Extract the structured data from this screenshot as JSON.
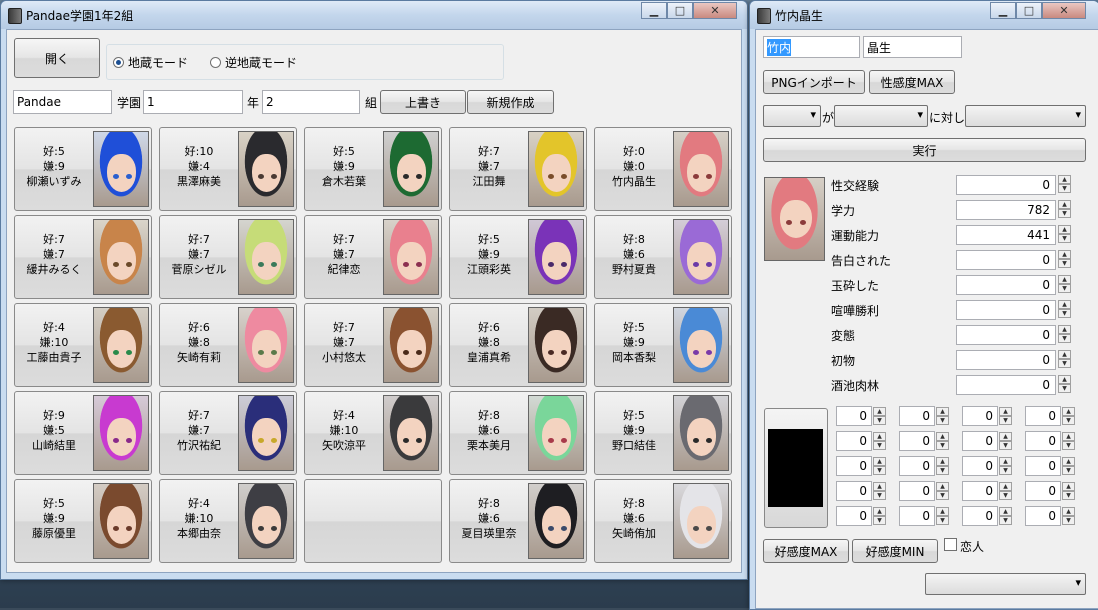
{
  "left_window": {
    "title": "Pandae学園1年2組",
    "open_button": "開く",
    "modes": [
      {
        "label": "地蔵モード",
        "selected": true
      },
      {
        "label": "逆地蔵モード",
        "selected": false
      }
    ],
    "school_name": "Pandae",
    "school_label": "学園",
    "year_value": "1",
    "year_label": "年",
    "class_value": "2",
    "class_label": "組",
    "overwrite_button": "上書き",
    "new_button": "新規作成",
    "students": [
      {
        "like": "好:5",
        "dislike": "嫌:9",
        "name": "柳瀬いずみ",
        "hair": "#1f4fd8",
        "bg": "#cfd8e8",
        "eye": "#2a5fcf"
      },
      {
        "like": "好:10",
        "dislike": "嫌:4",
        "name": "黒澤麻美",
        "hair": "#2a2a2e",
        "bg": "#d9d2c6",
        "eye": "#4a3a33"
      },
      {
        "like": "好:5",
        "dislike": "嫌:9",
        "name": "倉木若葉",
        "hair": "#1d6a32",
        "bg": "#cfcfcf",
        "eye": "#2a2a2a"
      },
      {
        "like": "好:7",
        "dislike": "嫌:7",
        "name": "江田舞",
        "hair": "#e3c52a",
        "bg": "#d8d1c4",
        "eye": "#7a4d2a"
      },
      {
        "like": "好:0",
        "dislike": "嫌:0",
        "name": "竹内晶生",
        "hair": "#e27a80",
        "bg": "#d6cfc6",
        "eye": "#8b3b3b"
      },
      {
        "like": "好:7",
        "dislike": "嫌:7",
        "name": "緩井みるく",
        "hair": "#c8844a",
        "bg": "#dad5ca",
        "eye": "#6b4a2a"
      },
      {
        "like": "好:7",
        "dislike": "嫌:7",
        "name": "菅原シゼル",
        "hair": "#c6dc78",
        "bg": "#d5d5cf",
        "eye": "#3a7a5a"
      },
      {
        "like": "好:7",
        "dislike": "嫌:7",
        "name": "紀律恋",
        "hair": "#e9808e",
        "bg": "#d8d2ca",
        "eye": "#8b3050"
      },
      {
        "like": "好:5",
        "dislike": "嫌:9",
        "name": "江頭彩英",
        "hair": "#7a33b8",
        "bg": "#d0c8d6",
        "eye": "#4a2a6a"
      },
      {
        "like": "好:8",
        "dislike": "嫌:6",
        "name": "野村夏貴",
        "hair": "#9a6ad6",
        "bg": "#d4cdd8",
        "eye": "#6a3aa8"
      },
      {
        "like": "好:4",
        "dislike": "嫌:10",
        "name": "工藤由貴子",
        "hair": "#8a5a30",
        "bg": "#d4cec4",
        "eye": "#2a8a4a"
      },
      {
        "like": "好:6",
        "dislike": "嫌:8",
        "name": "矢崎有莉",
        "hair": "#ee8aa0",
        "bg": "#d8d2cc",
        "eye": "#5a7a4a"
      },
      {
        "like": "好:7",
        "dislike": "嫌:7",
        "name": "小村悠太",
        "hair": "#8a5230",
        "bg": "#d3ccc2",
        "eye": "#4a2a1a"
      },
      {
        "like": "好:6",
        "dislike": "嫌:8",
        "name": "皇浦真希",
        "hair": "#3a2a24",
        "bg": "#d2ccc4",
        "eye": "#4a2a24"
      },
      {
        "like": "好:5",
        "dislike": "嫌:9",
        "name": "岡本香梨",
        "hair": "#4a8ad6",
        "bg": "#d0d6e0",
        "eye": "#7a3aa8"
      },
      {
        "like": "好:9",
        "dislike": "嫌:5",
        "name": "山崎結里",
        "hair": "#c83ad0",
        "bg": "#d6cad8",
        "eye": "#8a2a8a"
      },
      {
        "like": "好:7",
        "dislike": "嫌:7",
        "name": "竹沢祐紀",
        "hair": "#2a2e7a",
        "bg": "#ccccd8",
        "eye": "#c8a82a"
      },
      {
        "like": "好:4",
        "dislike": "嫌:10",
        "name": "矢吹涼平",
        "hair": "#3a3a3c",
        "bg": "#d0cccc",
        "eye": "#2a2a2a"
      },
      {
        "like": "好:8",
        "dislike": "嫌:6",
        "name": "栗本美月",
        "hair": "#7ad69a",
        "bg": "#d2dad4",
        "eye": "#a83a4a"
      },
      {
        "like": "好:5",
        "dislike": "嫌:9",
        "name": "野口結佳",
        "hair": "#6a6a70",
        "bg": "#d2d2d6",
        "eye": "#2a2a2a"
      },
      {
        "like": "好:5",
        "dislike": "嫌:9",
        "name": "藤原優里",
        "hair": "#7a4a2e",
        "bg": "#d4ccc4",
        "eye": "#6a3a2a"
      },
      {
        "like": "好:4",
        "dislike": "嫌:10",
        "name": "本郷由奈",
        "hair": "#3e3e44",
        "bg": "#d0cecc",
        "eye": "#3a3a3a"
      },
      {
        "empty": true
      },
      {
        "like": "好:8",
        "dislike": "嫌:6",
        "name": "夏目瑛里奈",
        "hair": "#1e1e22",
        "bg": "#d2cfcc",
        "eye": "#3a4a6a"
      },
      {
        "like": "好:8",
        "dislike": "嫌:6",
        "name": "矢崎侑加",
        "hair": "#e4e4e8",
        "bg": "#d8d8dc",
        "eye": "#4a4a4a"
      }
    ]
  },
  "right_window": {
    "title": "竹内晶生",
    "surname": "竹内",
    "given_name": "晶生",
    "png_import_button": "PNGインポート",
    "sensitivity_max_button": "性感度MAX",
    "relation_ga": "が",
    "relation_ni": "に対し",
    "execute_button": "実行",
    "portrait": {
      "hair": "#e27a80",
      "bg": "#d6cfc6",
      "eye": "#8b3b3b"
    },
    "stats": [
      {
        "label": "性交経験",
        "value": "0"
      },
      {
        "label": "学力",
        "value": "782"
      },
      {
        "label": "運動能力",
        "value": "441"
      },
      {
        "label": "告白された",
        "value": "0"
      },
      {
        "label": "玉砕した",
        "value": "0"
      },
      {
        "label": "喧嘩勝利",
        "value": "0"
      },
      {
        "label": "変態",
        "value": "0"
      },
      {
        "label": "初物",
        "value": "0"
      },
      {
        "label": "酒池肉林",
        "value": "0"
      }
    ],
    "grid_values": [
      "0",
      "0",
      "0",
      "0",
      "0",
      "0",
      "0",
      "0",
      "0",
      "0",
      "0",
      "0",
      "0",
      "0",
      "0",
      "0",
      "0",
      "0",
      "0",
      "0"
    ],
    "favor_max_button": "好感度MAX",
    "favor_min_button": "好感度MIN",
    "lover_label": "恋人"
  }
}
